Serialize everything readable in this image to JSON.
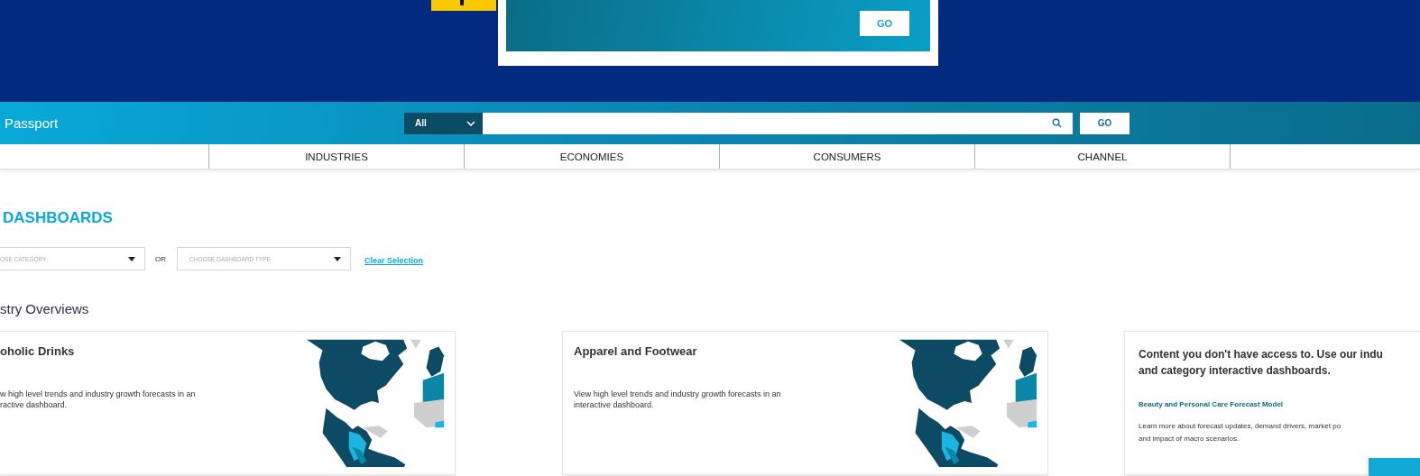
{
  "header": {
    "banner_button": "GO"
  },
  "navbar": {
    "brand": "Passport",
    "scope": "All",
    "search_button": "GO"
  },
  "menu": [
    "INDUSTRIES",
    "ECONOMIES",
    "CONSUMERS",
    "CHANNEL"
  ],
  "page_title": "DASHBOARDS",
  "filters": {
    "category_placeholder": "OSE CATEGORY",
    "separator": "OR",
    "type_placeholder": "CHOOSE DASHBOARD TYPE",
    "clear_link": "Clear Selection"
  },
  "section_title": "stry Overviews",
  "cards": [
    {
      "kind": "dashboard",
      "title": "oholic Drinks",
      "description": [
        "w high level trends and industry growth forecasts in an",
        "ractive dashboard."
      ]
    },
    {
      "kind": "dashboard",
      "title": "Apparel and Footwear",
      "description": [
        "View high level trends and industry growth forecasts in an",
        "interactive dashboard."
      ]
    },
    {
      "kind": "promo",
      "heading": [
        "Content you don't have access to. Use our indu",
        "and category interactive dashboards."
      ],
      "link": "Beauty and Personal Care Forecast Model",
      "description": [
        "Learn more about forecast updates, demand drivers, market po",
        "and impact of macro scenarios."
      ]
    }
  ]
}
